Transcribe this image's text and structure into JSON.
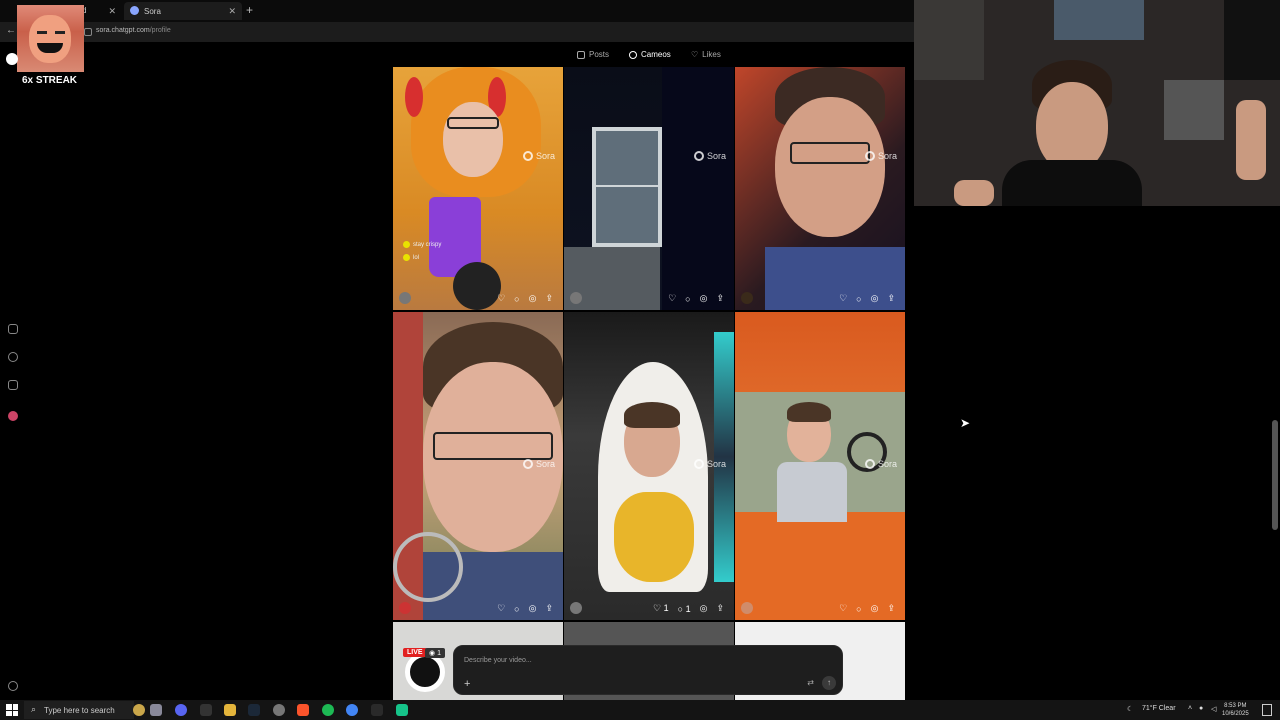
{
  "browser": {
    "tabs": [
      {
        "label": "d",
        "active": false
      },
      {
        "label": "Sora",
        "active": true
      }
    ],
    "new_tab": "+",
    "url": {
      "domain": "sora.chatgpt.com",
      "path": "/profile"
    }
  },
  "overlay": {
    "streak": "6x STREAK"
  },
  "profile_tabs": [
    {
      "label": "Posts",
      "icon": "posts-icon",
      "active": false
    },
    {
      "label": "Cameos",
      "icon": "cameos-icon",
      "active": true
    },
    {
      "label": "Likes",
      "icon": "heart-icon",
      "active": false
    }
  ],
  "watermark": "Sora",
  "tile1_caption": [
    "stay crispy",
    "lol"
  ],
  "tile5_counts": {
    "likes": "1",
    "comments": "1"
  },
  "live": {
    "label": "LIVE",
    "viewers": "1"
  },
  "prompt": {
    "placeholder": "Describe your video...",
    "add": "+",
    "send": "↑"
  },
  "taskbar": {
    "search_placeholder": "Type here to search",
    "weather": "71°F  Clear",
    "time": "8:53 PM",
    "date": "10/6/2025"
  },
  "colors": {
    "live_red": "#e12020",
    "background": "#000000",
    "caption_dot": "#e9e200"
  }
}
